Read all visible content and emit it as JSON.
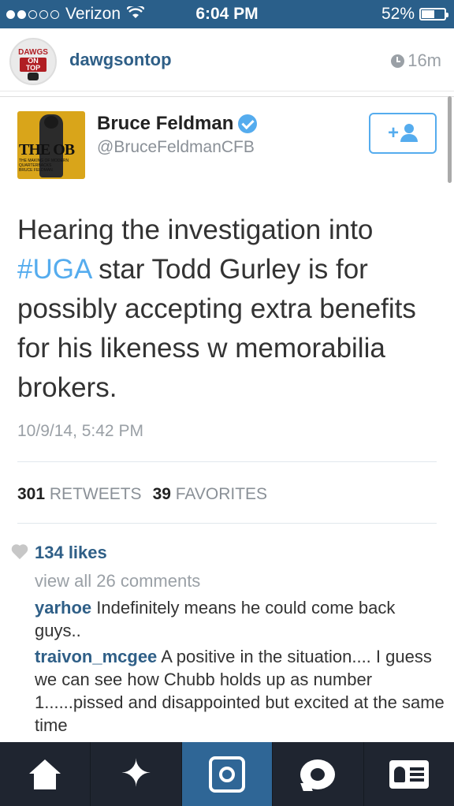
{
  "status_bar": {
    "carrier": "Verizon",
    "time": "6:04 PM",
    "battery": "52%",
    "battery_level": 0.52
  },
  "post": {
    "username": "dawgsontop",
    "time_ago": "16m",
    "avatar_text_top": "DAWGS",
    "avatar_text_bottom": "ON TOP"
  },
  "tweet": {
    "display_name": "Bruce Feldman",
    "handle": "@BruceFeldmanCFB",
    "avatar_title": "THE OB",
    "avatar_subtitle": "THE MAKING OF MODERN QUARTERBACKS",
    "avatar_author": "BRUCE FELDMAN",
    "follow_label": "+",
    "text_before_tag": "Hearing the investigation into ",
    "hashtag": "#UGA",
    "text_after_tag": " star Todd Gurley is for possibly accepting extra benefits for his likeness w memorabilia brokers.",
    "date": "10/9/14, 5:42 PM",
    "retweets_count": "301",
    "retweets_label": "RETWEETS",
    "favorites_count": "39",
    "favorites_label": "FAVORITES"
  },
  "social": {
    "likes": "134 likes",
    "view_all": "view all 26 comments",
    "comments": [
      {
        "user": "yarhoe",
        "text": " Indefinitely means he could come back guys.."
      },
      {
        "user": "traivon_mcgee",
        "text": " A positive in the situation.... I guess we can see how Chubb holds up as number 1......pissed and disappointed but excited at the same time"
      }
    ]
  },
  "tabbar": {
    "tabs": [
      {
        "name": "home",
        "icon": "home-icon"
      },
      {
        "name": "explore",
        "icon": "explore-icon"
      },
      {
        "name": "camera",
        "icon": "camera-icon"
      },
      {
        "name": "news",
        "icon": "news-icon"
      },
      {
        "name": "profile",
        "icon": "profile-icon"
      }
    ],
    "active_tab": "camera"
  },
  "colors": {
    "status_bar": "#2a5f8a",
    "username": "#2f5f87",
    "twitter_blue": "#55acee",
    "tab_bar": "#1f2530",
    "tab_active": "#2f6696"
  }
}
